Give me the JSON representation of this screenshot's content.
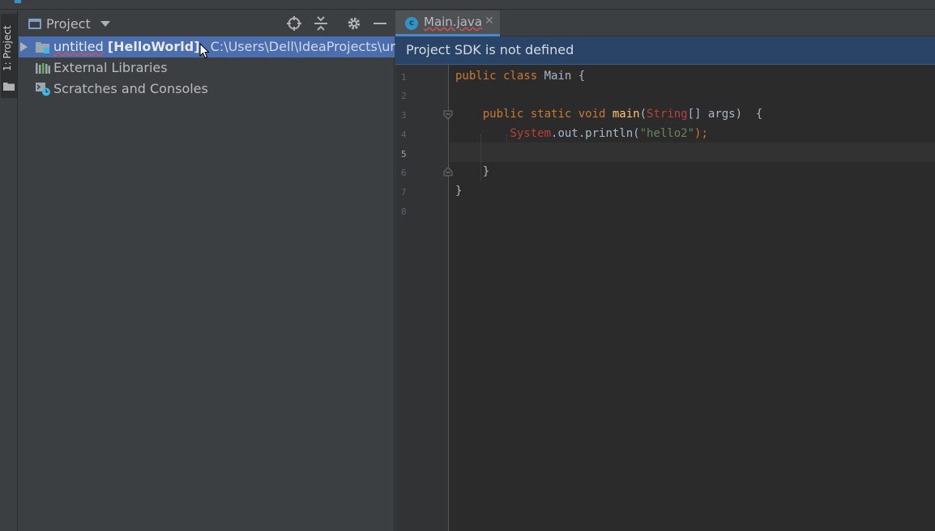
{
  "project_tool_window": {
    "stripe_label": "1: Project",
    "view_selector_label": "Project",
    "header_actions": [
      "locate-icon",
      "collapse-all-icon",
      "gear-icon",
      "minimize-icon"
    ],
    "tree": [
      {
        "name": "untitled",
        "module": "[HelloWorld]",
        "path": "C:\\Users\\Dell\\IdeaProjects\\untitled",
        "icon": "module-folder-icon",
        "selected": true,
        "expandable": true
      },
      {
        "name": "External Libraries",
        "icon": "libraries-icon",
        "selected": false
      },
      {
        "name": "Scratches and Consoles",
        "icon": "scratches-icon",
        "selected": false
      }
    ]
  },
  "editor": {
    "tab": {
      "label": "Main.java",
      "icon": "java-class-icon",
      "close": "✕"
    },
    "notification": "Project SDK is not defined",
    "line_numbers": [
      "1",
      "2",
      "3",
      "4",
      "5",
      "6",
      "7",
      "8"
    ],
    "current_line": "5",
    "code": [
      [
        {
          "t": "public class ",
          "c": "kw"
        },
        {
          "t": "Main {",
          "c": "cls"
        }
      ],
      [],
      [
        {
          "t": "    public static void ",
          "c": "kw"
        },
        {
          "t": "main",
          "c": "mth"
        },
        {
          "t": "(",
          "c": "cls"
        },
        {
          "t": "String",
          "c": "err"
        },
        {
          "t": "[] args)  {",
          "c": "cls"
        }
      ],
      [
        {
          "t": "        ",
          "c": "cls"
        },
        {
          "t": "System",
          "c": "err"
        },
        {
          "t": ".out.println(",
          "c": "cls"
        },
        {
          "t": "\"hello2\"",
          "c": "str"
        },
        {
          "t": ");",
          "c": "kw"
        }
      ],
      [],
      [
        {
          "t": "    }",
          "c": "cls"
        }
      ],
      [
        {
          "t": "}",
          "c": "cls"
        }
      ],
      []
    ]
  },
  "colors": {
    "selection": "#4b6eaf",
    "banner": "#294467",
    "editor_bg": "#2b2b2b",
    "panel_bg": "#3c3f41"
  }
}
